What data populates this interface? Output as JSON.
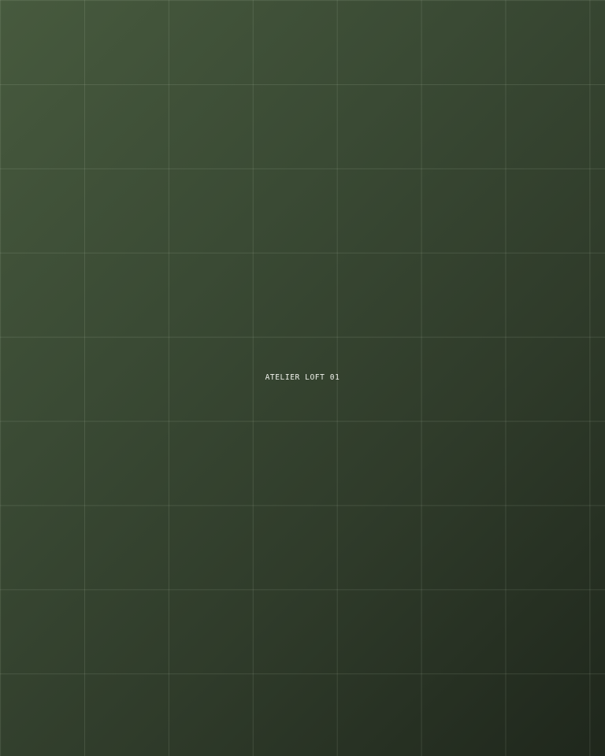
{
  "canvas": {
    "label": "ATELIER LOFT 01"
  },
  "colors": {
    "background_start": "#475a3e",
    "background_end": "#1f271c",
    "grid_line": "#c8d7be",
    "label_text": "#f2f4ee"
  }
}
